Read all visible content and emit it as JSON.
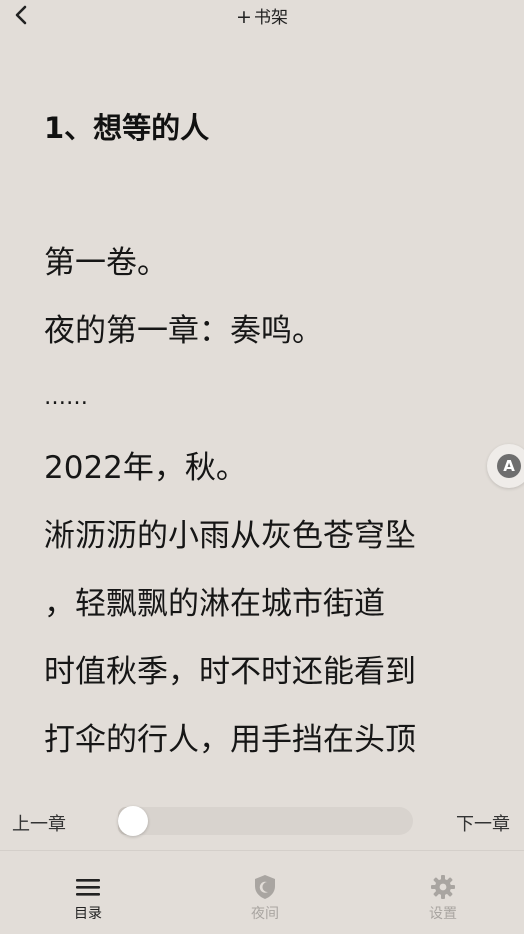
{
  "topbar": {
    "back_icon": "chevron-left-icon",
    "shelf_plus": "+",
    "shelf_label": "书架"
  },
  "reader": {
    "chapter_title": "1、想等的人",
    "paragraphs": [
      "第一卷。",
      "夜的第一章：奏鸣。",
      "……",
      "2022年，秋。",
      "淅沥沥的小雨从灰色苍穹坠",
      "，轻飘飘的淋在城市街道",
      "时值秋季，时不时还能看到",
      "打伞的行人，用手挡在头顶"
    ],
    "partial_line": "， ，"
  },
  "float_button": {
    "icon": "font-a-icon",
    "label": "A"
  },
  "progress": {
    "prev_label": "上一章",
    "next_label": "下一章",
    "value": 0.0
  },
  "bottom_nav": {
    "toc": {
      "icon": "menu-icon",
      "label": "目录"
    },
    "night": {
      "icon": "shield-moon-icon",
      "label": "夜间"
    },
    "settings": {
      "icon": "gear-icon",
      "label": "设置"
    }
  },
  "colors": {
    "background": "#e2ddd8",
    "text": "#161616",
    "inactive": "#a9a5a1"
  }
}
